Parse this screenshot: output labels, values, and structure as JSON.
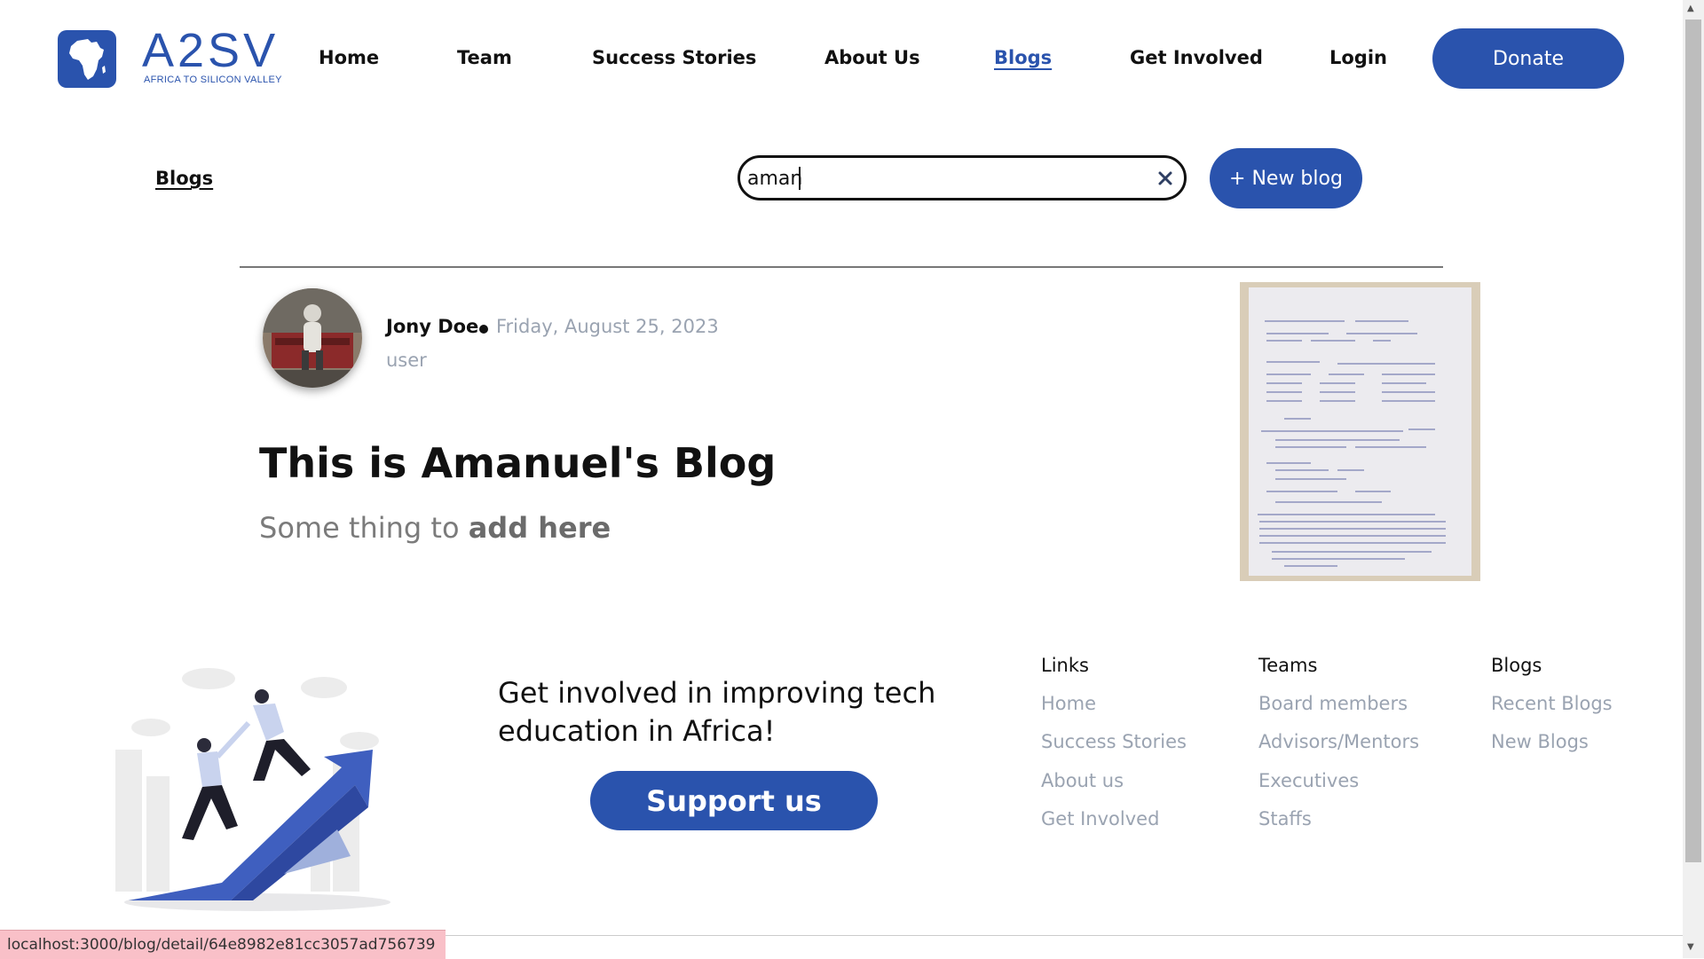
{
  "brand": {
    "mark": "A2SV",
    "tagline": "AFRICA TO SILICON VALLEY",
    "color": "#2a53ad"
  },
  "nav": {
    "links": [
      "Home",
      "Team",
      "Success Stories",
      "About Us",
      "Blogs",
      "Get Involved",
      "Login"
    ],
    "active": "Blogs",
    "donate_label": "Donate"
  },
  "page": {
    "heading": "Blogs",
    "search": {
      "value": "aman",
      "clear_icon": "close-icon"
    },
    "new_blog_label": "+ New blog"
  },
  "blog": {
    "author": "Jony Doe",
    "date": "Friday, August 25, 2023",
    "role": "user",
    "title": "This is Amanuel's Blog",
    "excerpt_plain": "Some thing to ",
    "excerpt_bold": "add here"
  },
  "footer": {
    "cta_title": "Get involved in improving tech education in Africa!",
    "support_label": "Support us",
    "columns": [
      {
        "heading": "Links",
        "items": [
          "Home",
          "Success Stories",
          "About us",
          "Get Involved"
        ]
      },
      {
        "heading": "Teams",
        "items": [
          "Board members",
          "Advisors/Mentors",
          "Executives",
          "Staffs"
        ]
      },
      {
        "heading": "Blogs",
        "items": [
          "Recent Blogs",
          "New Blogs"
        ]
      }
    ]
  },
  "status_url": "localhost:3000/blog/detail/64e8982e81cc3057ad756739"
}
